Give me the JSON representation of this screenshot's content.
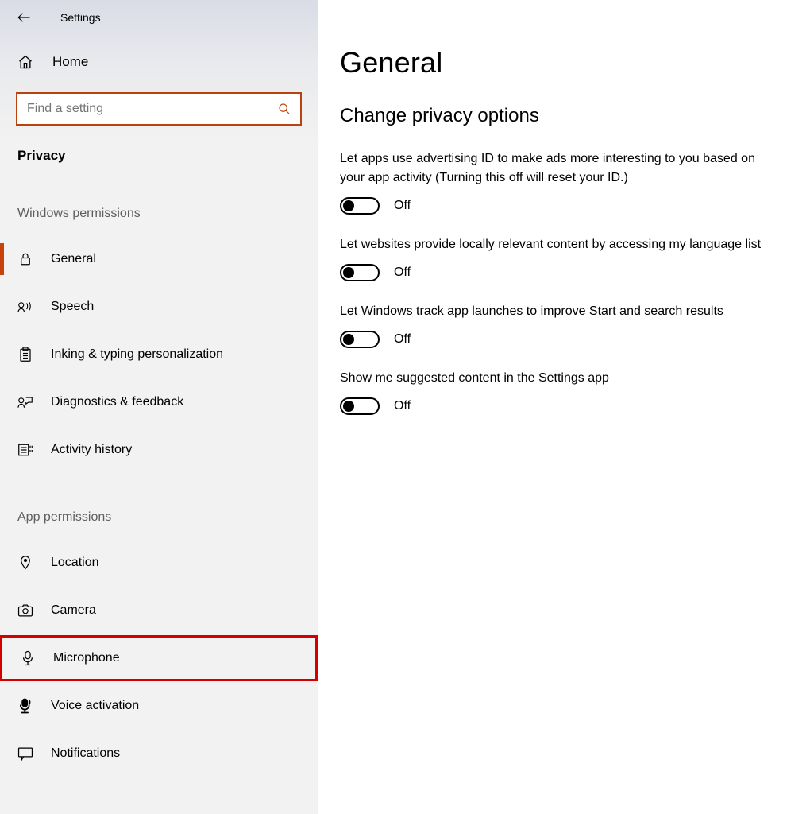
{
  "window": {
    "title": "Settings"
  },
  "home": {
    "label": "Home"
  },
  "search": {
    "placeholder": "Find a setting"
  },
  "section": {
    "label": "Privacy"
  },
  "groups": {
    "windows_permissions": "Windows permissions",
    "app_permissions": "App permissions"
  },
  "nav": {
    "general": "General",
    "speech": "Speech",
    "inking": "Inking & typing personalization",
    "diagnostics": "Diagnostics & feedback",
    "activity": "Activity history",
    "location": "Location",
    "camera": "Camera",
    "microphone": "Microphone",
    "voice_activation": "Voice activation",
    "notifications": "Notifications"
  },
  "page": {
    "title": "General",
    "subhead": "Change privacy options",
    "settings": [
      {
        "desc": "Let apps use advertising ID to make ads more interesting to you based on your app activity (Turning this off will reset your ID.)",
        "state": "Off"
      },
      {
        "desc": "Let websites provide locally relevant content by accessing my language list",
        "state": "Off"
      },
      {
        "desc": "Let Windows track app launches to improve Start and search results",
        "state": "Off"
      },
      {
        "desc": "Show me suggested content in the Settings app",
        "state": "Off"
      }
    ]
  }
}
